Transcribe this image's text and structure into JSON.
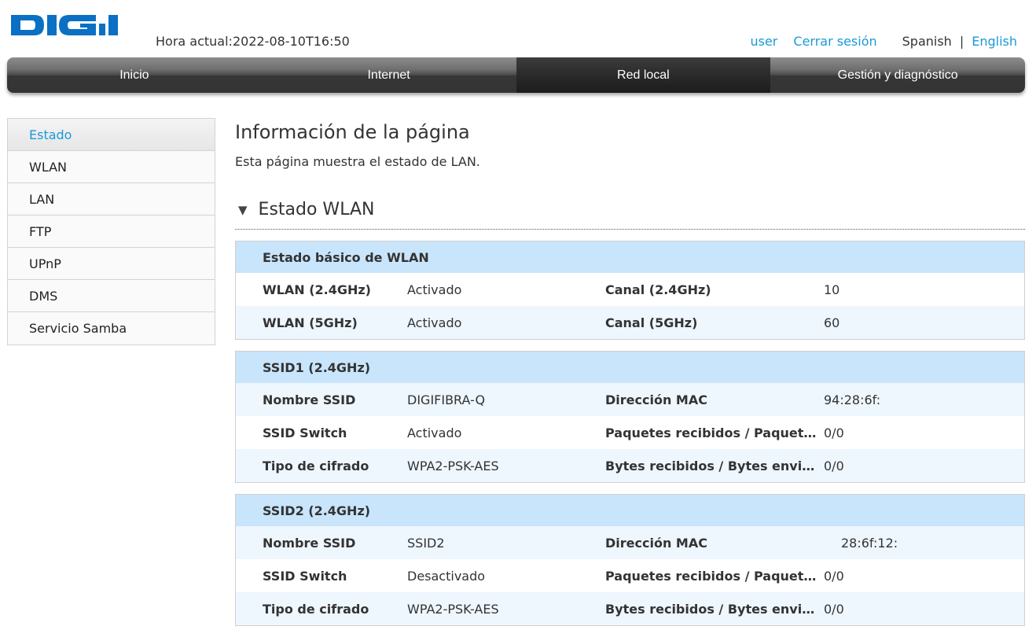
{
  "header": {
    "logo_text": "DIGI",
    "brand_color": "#0a70c4",
    "current_time_label": "Hora actual:",
    "current_time_value": "2022-08-10T16:50",
    "user_link": "user",
    "logout_link": "Cerrar sesión",
    "lang_current": "Spanish",
    "lang_separator": "|",
    "lang_other": "English",
    "link_color": "#1a9ad6"
  },
  "nav": {
    "items": [
      {
        "label": "Inicio",
        "active": false
      },
      {
        "label": "Internet",
        "active": false
      },
      {
        "label": "Red local",
        "active": true
      },
      {
        "label": "Gestión y diagnóstico",
        "active": false
      }
    ]
  },
  "sidebar": {
    "items": [
      {
        "label": "Estado",
        "active": true
      },
      {
        "label": "WLAN",
        "active": false
      },
      {
        "label": "LAN",
        "active": false
      },
      {
        "label": "FTP",
        "active": false
      },
      {
        "label": "UPnP",
        "active": false
      },
      {
        "label": "DMS",
        "active": false
      },
      {
        "label": "Servicio Samba",
        "active": false
      }
    ]
  },
  "main": {
    "title": "Información de la página",
    "description": "Esta página muestra el estado de LAN.",
    "section": {
      "icon": "triangle-down-icon",
      "title": "Estado WLAN"
    },
    "basic": {
      "title": "Estado básico de WLAN",
      "rows": [
        {
          "label1": "WLAN (2.4GHz)",
          "value1": "Activado",
          "label2": "Canal (2.4GHz)",
          "value2": "10"
        },
        {
          "label1": "WLAN (5GHz)",
          "value1": "Activado",
          "label2": "Canal (5GHz)",
          "value2": "60"
        }
      ]
    },
    "ssid1": {
      "title": "SSID1 (2.4GHz)",
      "rows": [
        {
          "label1": "Nombre SSID",
          "value1": "DIGIFIBRA-Q",
          "label2": "Dirección MAC",
          "value2": "94:28:6f:"
        },
        {
          "label1": "SSID Switch",
          "value1": "Activado",
          "label2": "Paquetes recibidos / Paquetes ...",
          "value2": "0/0"
        },
        {
          "label1": "Tipo de cifrado",
          "value1": "WPA2-PSK-AES",
          "label2": "Bytes recibidos / Bytes enviados",
          "value2": "0/0"
        }
      ]
    },
    "ssid2": {
      "title": "SSID2 (2.4GHz)",
      "rows": [
        {
          "label1": "Nombre SSID",
          "value1": "SSID2",
          "label2": "Dirección MAC",
          "value2": "28:6f:12:"
        },
        {
          "label1": "SSID Switch",
          "value1": "Desactivado",
          "label2": "Paquetes recibidos / Paquetes ...",
          "value2": "0/0"
        },
        {
          "label1": "Tipo de cifrado",
          "value1": "WPA2-PSK-AES",
          "label2": "Bytes recibidos / Bytes enviados",
          "value2": "0/0"
        }
      ]
    }
  }
}
